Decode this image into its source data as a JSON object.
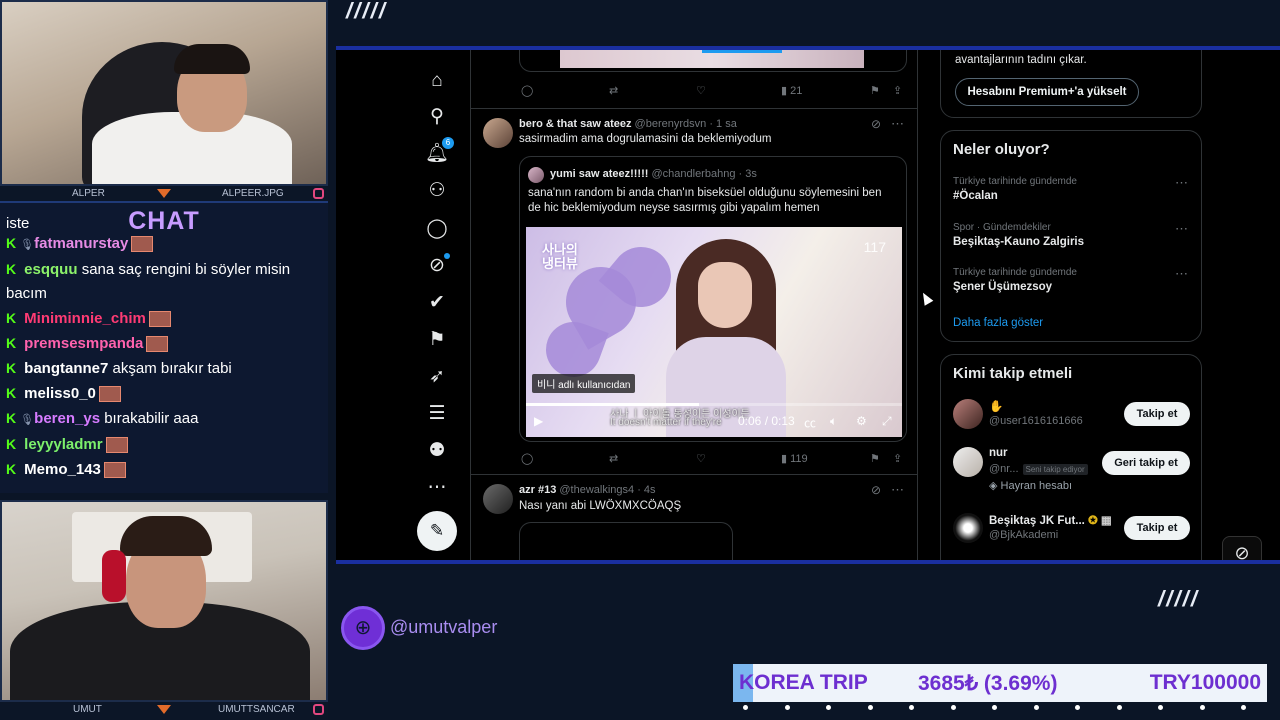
{
  "stream": {
    "top_cam": {
      "left_name": "ALPER",
      "right_name": "ALPEER.JPG"
    },
    "bottom_cam": {
      "left_name": "UMUT",
      "right_name": "UMUTTSANCAR"
    },
    "chat_title": "CHAT",
    "chat": [
      {
        "user": "",
        "message": "iste",
        "color": "#ffffff",
        "partial": true
      },
      {
        "user": "fatmanurstay",
        "message": "",
        "color": "#e68be4",
        "mic": true,
        "emote": true
      },
      {
        "user": "esqquu",
        "message": "sana saç rengini bi söyler misin bacım",
        "color": "#8cf26a"
      },
      {
        "user": "Miniminnie_chim",
        "message": "",
        "color": "#ff3b74",
        "emote": true
      },
      {
        "user": "premsesmpanda",
        "message": "",
        "color": "#ff62ad",
        "emote": true
      },
      {
        "user": "bangtanne7",
        "message": "akşam bırakır tabi",
        "color": "#ffffff"
      },
      {
        "user": "meliss0_0",
        "message": "",
        "color": "#ffffff",
        "emote": true
      },
      {
        "user": "beren_ys",
        "message": "bırakabilir aaa",
        "color": "#d67bff",
        "mic": true
      },
      {
        "user": "leyyyladmr",
        "message": "",
        "color": "#7cf06b",
        "emote": true
      },
      {
        "user": "Memo_143",
        "message": "",
        "color": "#ffffff",
        "emote": true
      }
    ],
    "social_handle": "@umutvalper",
    "goal": {
      "name": "KOREA TRIP",
      "amount": "3685₺ (3.69%)",
      "target": "TRY100000",
      "progress": 0.0369
    },
    "accent": "#1d3aa8"
  },
  "x": {
    "nav_icons": [
      "home-icon",
      "search-icon",
      "bell-icon",
      "add-person-icon",
      "message-icon",
      "grok-icon",
      "verified-icon",
      "bookmark-icon",
      "rocket-icon",
      "list-icon",
      "profile-icon",
      "more-icon"
    ],
    "notification_count": "6",
    "top_actions": {
      "views": "21"
    },
    "tweet1": {
      "name": "bero & that saw ateez",
      "handle": "@berenyrdsvn",
      "time": "· 1 sa",
      "text": "sasirmadim ama dogrulamasini da beklemiyodum",
      "quote": {
        "name": "yumi saw ateez!!!!!",
        "handle": "@chandlerbahng",
        "time": "· 3s",
        "text_line1": "sana'nın random bi anda chan'ın biseksüel olduğunu söylemesini ben",
        "text_line2": "de hic beklemiyodum neyse sasırmış gibi yapalım hemen",
        "video": {
          "logo_line1": "사나의",
          "logo_line2": "냉터뷰",
          "corner_num": "117",
          "tag": "비니 adlı kullanıcıdan",
          "subtitle_ko": "사나 ㅣ 아이돌 동성이든 이성이든",
          "subtitle_en": "It doesn't matter if they're",
          "time": "0:06 / 0:13",
          "progress": 0.46
        }
      },
      "views": "119"
    },
    "tweet2": {
      "name": "azr #13",
      "handle": "@thewalkings4",
      "time": "· 4s",
      "text": "Nası yanı abi LWÖXMXCÖAQŞ"
    },
    "premium": {
      "partial_text": "avantajlarının tadını çıkar.",
      "button": "Hesabını Premium+'a yükselt"
    },
    "trends": {
      "title": "Neler oluyor?",
      "items": [
        {
          "meta": "Türkiye tarihinde gündemde",
          "name": "#Öcalan"
        },
        {
          "meta": "Spor · Gündemdekiler",
          "name": "Beşiktaş-Kauno Zalgiris"
        },
        {
          "meta": "Türkiye tarihinde gündemde",
          "name": "Şener Üşümezsoy"
        }
      ],
      "more": "Daha fazla göster"
    },
    "who_to_follow": {
      "title": "Kimi takip etmeli",
      "items": [
        {
          "name": "",
          "handle": "@user1616161666",
          "button": "Takip et"
        },
        {
          "name": "nur",
          "handle": "@nr...",
          "follows_you": "Seni takip ediyor",
          "extra": "Hayran hesabı",
          "button": "Geri takip et"
        },
        {
          "name": "Beşiktaş JK Fut...",
          "handle": "@BjkAkademi",
          "button": "Takip et"
        }
      ]
    }
  }
}
